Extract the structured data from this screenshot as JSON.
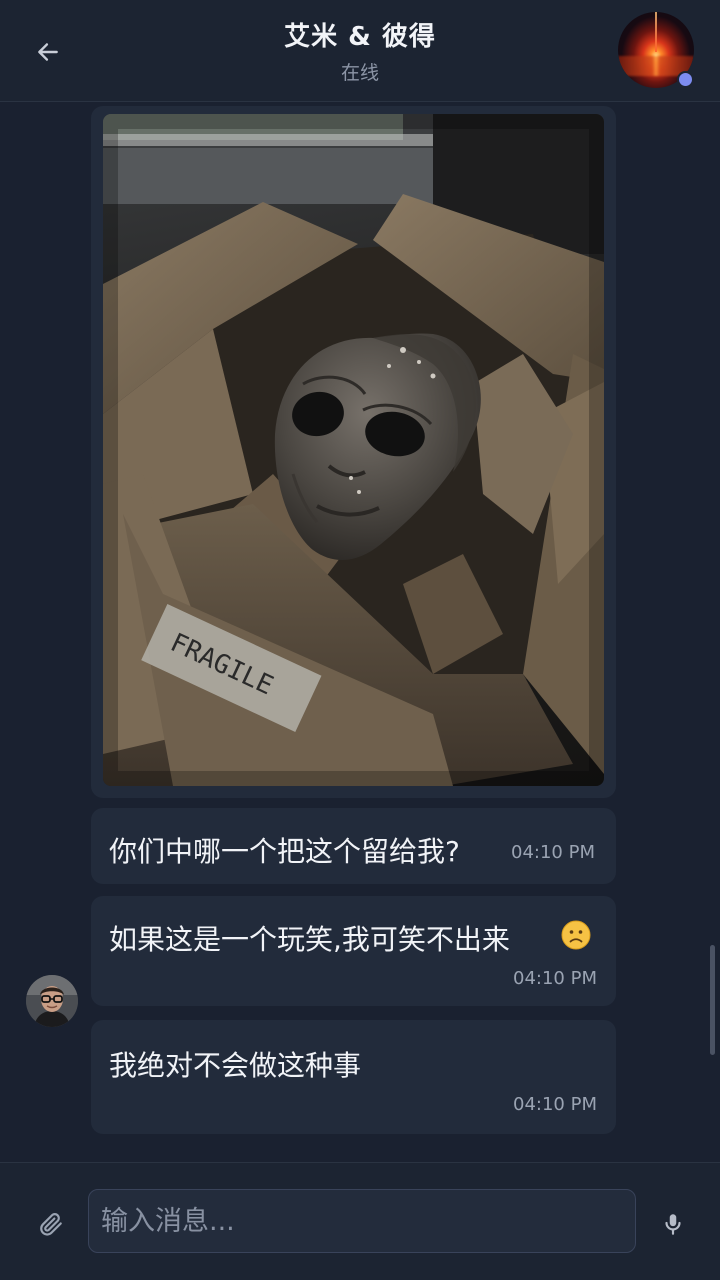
{
  "header": {
    "back_icon": "arrow-left-icon",
    "title": "艾米 & 彼得",
    "status": "在线",
    "avatar_icon": "contact-avatar",
    "online_color": "#7d8cf0"
  },
  "messages": [
    {
      "type": "image",
      "alt": "alien mask in cardboard box",
      "box_label": "FRAGILE"
    },
    {
      "type": "text",
      "text": "你们中哪一个把这个留给我?",
      "time": "04:10 PM"
    },
    {
      "type": "text",
      "text": "如果这是一个玩笑,我可笑不出来",
      "emoji": "slightly-frowning-face",
      "time": "04:10 PM"
    },
    {
      "type": "text",
      "text": "我绝对不会做这种事",
      "time": "04:10 PM"
    }
  ],
  "composer": {
    "attach_icon": "paperclip-icon",
    "placeholder": "输入消息...",
    "mic_icon": "microphone-icon"
  },
  "colors": {
    "background": "#1a2130",
    "bubble": "#222b3b",
    "text": "#f1f3f7",
    "muted": "#9aa3b2"
  }
}
